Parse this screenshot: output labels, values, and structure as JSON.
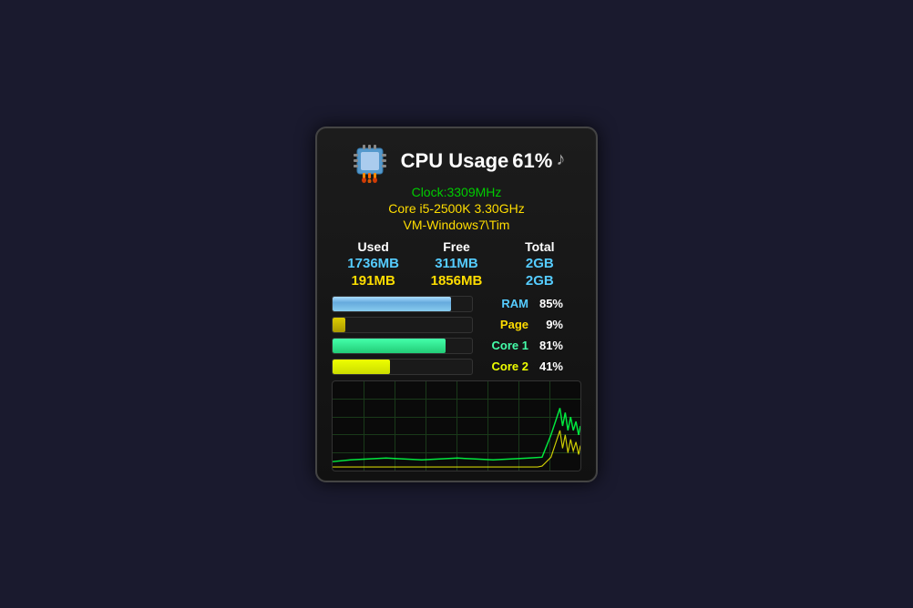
{
  "widget": {
    "title": "CPU Usage",
    "percent": "61%",
    "clock_label": "Clock:",
    "clock_value": "3309MHz",
    "core_info": "Core i5-2500K 3.30GHz",
    "vm_name": "VM-Windows7\\Tim",
    "columns": {
      "used": "Used",
      "free": "Free",
      "total": "Total"
    },
    "memory_rows": [
      {
        "used": "1736MB",
        "free": "311MB",
        "total": "2GB"
      },
      {
        "used": "191MB",
        "free": "1856MB",
        "total": "2GB"
      }
    ],
    "bars": [
      {
        "label": "RAM",
        "percent": "85%",
        "fill_pct": 85,
        "type": "ram"
      },
      {
        "label": "Page",
        "percent": "9%",
        "fill_pct": 9,
        "type": "page"
      },
      {
        "label": "Core 1",
        "percent": "81%",
        "fill_pct": 81,
        "type": "core1"
      },
      {
        "label": "Core 2",
        "percent": "41%",
        "fill_pct": 41,
        "type": "core2"
      }
    ]
  }
}
